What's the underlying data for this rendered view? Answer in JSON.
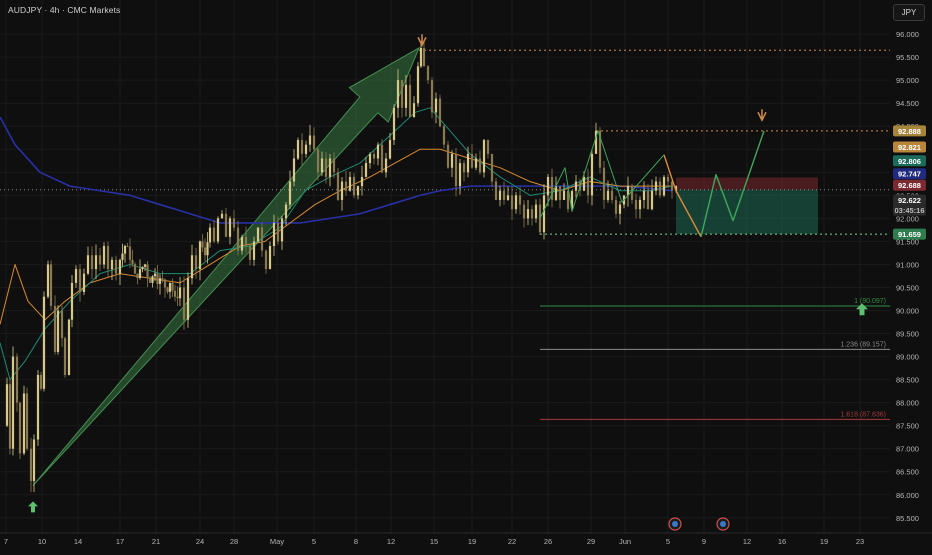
{
  "header": {
    "title": "AUDJPY · 4h · CMC Markets",
    "currency": "JPY"
  },
  "chart_data": {
    "type": "candlestick",
    "symbol": "AUDJPY",
    "timeframe": "4h",
    "ylim": [
      85.3,
      96.35
    ],
    "y_ticks": [
      "96.000",
      "95.500",
      "95.000",
      "94.500",
      "94.000",
      "93.500",
      "93.000",
      "92.500",
      "92.000",
      "91.500",
      "91.000",
      "90.500",
      "90.000",
      "89.500",
      "89.000",
      "88.500",
      "88.000",
      "87.500",
      "87.000",
      "86.500",
      "86.000",
      "85.500"
    ],
    "x_ticks": [
      "7",
      "10",
      "14",
      "17",
      "21",
      "24",
      "28",
      "May",
      "5",
      "8",
      "12",
      "15",
      "19",
      "22",
      "26",
      "29",
      "Jun",
      "5",
      "9",
      "12",
      "16",
      "19",
      "23"
    ],
    "price_path": [
      [
        "3",
        "87.5"
      ],
      [
        "7",
        "88.4"
      ],
      [
        "10",
        "87.0"
      ],
      [
        "13",
        "89.0"
      ],
      [
        "17",
        "88.0"
      ],
      [
        "20",
        "86.9"
      ],
      [
        "24",
        "88.2"
      ],
      [
        "27",
        "87.0"
      ],
      [
        "31",
        "86.3"
      ],
      [
        "34",
        "87.2"
      ],
      [
        "38",
        "88.6"
      ],
      [
        "41",
        "88.3"
      ],
      [
        "44",
        "90.3"
      ],
      [
        "48",
        "91.0"
      ],
      [
        "51",
        "90.1"
      ],
      [
        "55",
        "89.1"
      ],
      [
        "58",
        "90.0"
      ],
      [
        "62",
        "89.4"
      ],
      [
        "65",
        "88.6"
      ],
      [
        "69",
        "89.8"
      ],
      [
        "72",
        "90.6"
      ],
      [
        "76",
        "90.9"
      ],
      [
        "80",
        "90.4"
      ],
      [
        "84",
        "90.8"
      ],
      [
        "88",
        "91.2"
      ],
      [
        "92",
        "90.9"
      ],
      [
        "96",
        "91.2"
      ],
      [
        "100",
        "91.0"
      ],
      [
        "104",
        "91.4"
      ],
      [
        "108",
        "90.9"
      ],
      [
        "112",
        "91.1"
      ],
      [
        "116",
        "90.8"
      ],
      [
        "120",
        "91.1"
      ],
      [
        "125",
        "91.4"
      ],
      [
        "130",
        "91.1"
      ],
      [
        "135",
        "90.8"
      ],
      [
        "140",
        "90.9"
      ],
      [
        "145",
        "91.0"
      ],
      [
        "150",
        "90.6"
      ],
      [
        "155",
        "90.8"
      ],
      [
        "160",
        "90.7"
      ],
      [
        "165",
        "90.5"
      ],
      [
        "170",
        "90.6"
      ],
      [
        "175",
        "90.3"
      ],
      [
        "180",
        "90.5"
      ],
      [
        "184",
        "89.8"
      ],
      [
        "188",
        "90.7"
      ],
      [
        "192",
        "91.2"
      ],
      [
        "196",
        "90.9"
      ],
      [
        "200",
        "91.5"
      ],
      [
        "205",
        "91.2"
      ],
      [
        "210",
        "91.8"
      ],
      [
        "214",
        "91.5"
      ],
      [
        "218",
        "92.0"
      ],
      [
        "222",
        "92.1"
      ],
      [
        "226",
        "91.6"
      ],
      [
        "230",
        "92.0"
      ],
      [
        "234",
        "91.8"
      ],
      [
        "238",
        "91.3"
      ],
      [
        "242",
        "91.6"
      ],
      [
        "246",
        "91.4"
      ],
      [
        "250",
        "91.1"
      ],
      [
        "254",
        "91.5"
      ],
      [
        "258",
        "91.8"
      ],
      [
        "262",
        "91.3"
      ],
      [
        "266",
        "90.9"
      ],
      [
        "270",
        "91.4"
      ],
      [
        "274",
        "91.9"
      ],
      [
        "278",
        "91.5"
      ],
      [
        "282",
        "92.0"
      ],
      [
        "286",
        "92.3"
      ],
      [
        "290",
        "92.8"
      ],
      [
        "294",
        "93.3"
      ],
      [
        "298",
        "93.7"
      ],
      [
        "302",
        "93.4"
      ],
      [
        "306",
        "93.6"
      ],
      [
        "310",
        "93.8"
      ],
      [
        "314",
        "93.5"
      ],
      [
        "318",
        "93.0"
      ],
      [
        "322",
        "93.3"
      ],
      [
        "326",
        "92.9"
      ],
      [
        "330",
        "93.3"
      ],
      [
        "334",
        "93.0"
      ],
      [
        "338",
        "92.4"
      ],
      [
        "342",
        "92.8"
      ],
      [
        "346",
        "92.6"
      ],
      [
        "350",
        "92.9"
      ],
      [
        "354",
        "92.5"
      ],
      [
        "358",
        "92.7"
      ],
      [
        "362",
        "92.9"
      ],
      [
        "366",
        "93.2"
      ],
      [
        "370",
        "93.4"
      ],
      [
        "374",
        "93.3"
      ],
      [
        "378",
        "93.6"
      ],
      [
        "382",
        "93.0"
      ],
      [
        "386",
        "93.3"
      ],
      [
        "390",
        "93.7"
      ],
      [
        "394",
        "94.4"
      ],
      [
        "398",
        "95.0"
      ],
      [
        "402",
        "94.4"
      ],
      [
        "406",
        "94.9"
      ],
      [
        "410",
        "94.2"
      ],
      [
        "414",
        "94.5"
      ],
      [
        "418",
        "95.3"
      ],
      [
        "421",
        "95.7"
      ],
      [
        "424",
        "95.3"
      ],
      [
        "428",
        "95.0"
      ],
      [
        "432",
        "94.3"
      ],
      [
        "436",
        "94.6"
      ],
      [
        "440",
        "94.0"
      ],
      [
        "444",
        "93.6"
      ],
      [
        "448",
        "93.1"
      ],
      [
        "452",
        "93.4"
      ],
      [
        "456",
        "92.7"
      ],
      [
        "460",
        "93.2"
      ],
      [
        "464",
        "93.0"
      ],
      [
        "468",
        "93.4"
      ],
      [
        "472",
        "93.1"
      ],
      [
        "476",
        "93.3"
      ],
      [
        "480",
        "93.0"
      ],
      [
        "484",
        "93.7"
      ],
      [
        "488",
        "93.4"
      ],
      [
        "492",
        "92.8"
      ],
      [
        "496",
        "92.4"
      ],
      [
        "500",
        "92.6"
      ],
      [
        "504",
        "92.4"
      ],
      [
        "508",
        "92.5"
      ],
      [
        "512",
        "92.2"
      ],
      [
        "516",
        "92.5"
      ],
      [
        "520",
        "92.3"
      ],
      [
        "524",
        "92.0"
      ],
      [
        "528",
        "92.2"
      ],
      [
        "532",
        "92.0"
      ],
      [
        "536",
        "92.3"
      ],
      [
        "540",
        "91.7"
      ],
      [
        "544",
        "92.5"
      ],
      [
        "548",
        "92.9"
      ],
      [
        "552",
        "92.4"
      ],
      [
        "556",
        "92.7"
      ],
      [
        "560",
        "92.4"
      ],
      [
        "564",
        "92.6"
      ],
      [
        "568",
        "92.2"
      ],
      [
        "572",
        "92.6"
      ],
      [
        "576",
        "92.8"
      ],
      [
        "580",
        "92.6"
      ],
      [
        "584",
        "92.9"
      ],
      [
        "588",
        "92.5"
      ],
      [
        "592",
        "93.4"
      ],
      [
        "596",
        "93.9"
      ],
      [
        "600",
        "93.1"
      ],
      [
        "604",
        "92.4"
      ],
      [
        "608",
        "92.6"
      ],
      [
        "612",
        "92.4"
      ],
      [
        "616",
        "92.1"
      ],
      [
        "620",
        "92.3"
      ],
      [
        "624",
        "92.5"
      ],
      [
        "628",
        "92.7"
      ],
      [
        "632",
        "92.4"
      ],
      [
        "636",
        "92.2"
      ],
      [
        "640",
        "92.4"
      ],
      [
        "644",
        "92.6"
      ],
      [
        "648",
        "92.2"
      ],
      [
        "652",
        "92.6"
      ],
      [
        "656",
        "92.8"
      ],
      [
        "660",
        "92.5"
      ],
      [
        "664",
        "92.9"
      ],
      [
        "668",
        "92.8"
      ],
      [
        "672",
        "92.6"
      ],
      [
        "676",
        "92.7"
      ]
    ],
    "ema_slow": [
      [
        "0",
        "94.2"
      ],
      [
        "15",
        "93.6"
      ],
      [
        "40",
        "93.0"
      ],
      [
        "70",
        "92.7"
      ],
      [
        "100",
        "92.6"
      ],
      [
        "130",
        "92.5"
      ],
      [
        "160",
        "92.3"
      ],
      [
        "190",
        "92.1"
      ],
      [
        "220",
        "91.9"
      ],
      [
        "245",
        "91.9"
      ],
      [
        "270",
        "91.9"
      ],
      [
        "300",
        "91.9"
      ],
      [
        "330",
        "92.0"
      ],
      [
        "360",
        "92.1"
      ],
      [
        "390",
        "92.3"
      ],
      [
        "420",
        "92.5"
      ],
      [
        "440",
        "92.6"
      ],
      [
        "470",
        "92.7"
      ],
      [
        "500",
        "92.7"
      ],
      [
        "530",
        "92.7"
      ],
      [
        "560",
        "92.7"
      ],
      [
        "590",
        "92.7"
      ],
      [
        "620",
        "92.7"
      ],
      [
        "650",
        "92.65"
      ],
      [
        "672",
        "92.6"
      ]
    ],
    "ema_fast": [
      [
        "0",
        "89.7"
      ],
      [
        "15",
        "91.0"
      ],
      [
        "28",
        "90.2"
      ],
      [
        "45",
        "89.8"
      ],
      [
        "65",
        "90.2"
      ],
      [
        "90",
        "90.6"
      ],
      [
        "120",
        "90.8"
      ],
      [
        "150",
        "90.7"
      ],
      [
        "180",
        "90.6"
      ],
      [
        "210",
        "91.0"
      ],
      [
        "240",
        "91.4"
      ],
      [
        "265",
        "91.5"
      ],
      [
        "290",
        "91.9"
      ],
      [
        "315",
        "92.3"
      ],
      [
        "340",
        "92.6"
      ],
      [
        "370",
        "92.9"
      ],
      [
        "395",
        "93.2"
      ],
      [
        "420",
        "93.5"
      ],
      [
        "440",
        "93.5"
      ],
      [
        "470",
        "93.3"
      ],
      [
        "500",
        "93.1"
      ],
      [
        "530",
        "92.8"
      ],
      [
        "560",
        "92.6"
      ],
      [
        "590",
        "92.8"
      ],
      [
        "620",
        "92.7"
      ],
      [
        "650",
        "92.7"
      ],
      [
        "672",
        "92.7"
      ]
    ],
    "ema_teal": [
      [
        "0",
        "89.3"
      ],
      [
        "10",
        "88.5"
      ],
      [
        "25",
        "88.9"
      ],
      [
        "45",
        "89.6"
      ],
      [
        "70",
        "90.2"
      ],
      [
        "100",
        "90.8"
      ],
      [
        "130",
        "91.0"
      ],
      [
        "160",
        "90.8"
      ],
      [
        "190",
        "90.8"
      ],
      [
        "220",
        "91.3"
      ],
      [
        "250",
        "91.4"
      ],
      [
        "280",
        "91.8"
      ],
      [
        "305",
        "92.6"
      ],
      [
        "330",
        "92.9"
      ],
      [
        "360",
        "93.2"
      ],
      [
        "390",
        "93.8"
      ],
      [
        "415",
        "94.3"
      ],
      [
        "430",
        "94.4"
      ],
      [
        "450",
        "93.9"
      ],
      [
        "470",
        "93.4"
      ],
      [
        "500",
        "92.9"
      ],
      [
        "530",
        "92.5"
      ],
      [
        "560",
        "92.6"
      ],
      [
        "590",
        "92.9"
      ],
      [
        "620",
        "92.6"
      ],
      [
        "650",
        "92.6"
      ],
      [
        "672",
        "92.7"
      ]
    ],
    "impulse_arrow": {
      "from": [
        "33",
        "86.2"
      ],
      "to": [
        "419",
        "95.7"
      ]
    },
    "annotations": {
      "high_line": "95.650",
      "target_line": "93.900",
      "target_arrow_price": "94.0",
      "low_line": "91.659",
      "current_line": "92.622",
      "low_marker_price": "85.9"
    },
    "position": {
      "entry": "92.622",
      "stop": "92.888",
      "target": "91.659"
    },
    "projection_orange": [
      [
        "664",
        "93.38"
      ],
      [
        "676",
        "92.6"
      ],
      [
        "701",
        "91.6"
      ]
    ],
    "projection_green": [
      [
        "701",
        "91.6"
      ],
      [
        "716",
        "92.95"
      ],
      [
        "733",
        "91.95"
      ],
      [
        "764",
        "93.9"
      ]
    ],
    "fib_levels": [
      {
        "label": "1 (90.097)",
        "price": "90.097",
        "color": "#2f8f45"
      },
      {
        "label": "1.236 (89.157)",
        "price": "89.157",
        "color": "#8a8a8a"
      },
      {
        "label": "1.618 (87.636)",
        "price": "87.636",
        "color": "#a33a3a"
      }
    ],
    "price_badges": [
      {
        "text": "92.888",
        "price": "93.90",
        "bg": "#a6843a",
        "fg": "#ffffff"
      },
      {
        "text": "92.821",
        "price": "93.55",
        "bg": "#b8863b",
        "fg": "#ffffff"
      },
      {
        "text": "92.806",
        "price": "93.25",
        "bg": "#1c6a5c",
        "fg": "#ffffff"
      },
      {
        "text": "92.747",
        "price": "92.97",
        "bg": "#1f2a80",
        "fg": "#ffffff"
      },
      {
        "text": "92.688",
        "price": "92.72",
        "bg": "#7a2a30",
        "fg": "#ffffff"
      },
      {
        "text": "92.622",
        "price": "92.40",
        "bg": "#2a2a2a",
        "fg": "#ffffff"
      },
      {
        "text": "03:45:16",
        "price": "92.18",
        "bg": "#2a2a2a",
        "fg": "#bbbbbb"
      },
      {
        "text": "91.659",
        "price": "91.659",
        "bg": "#2e7d4f",
        "fg": "#ffffff"
      }
    ]
  }
}
